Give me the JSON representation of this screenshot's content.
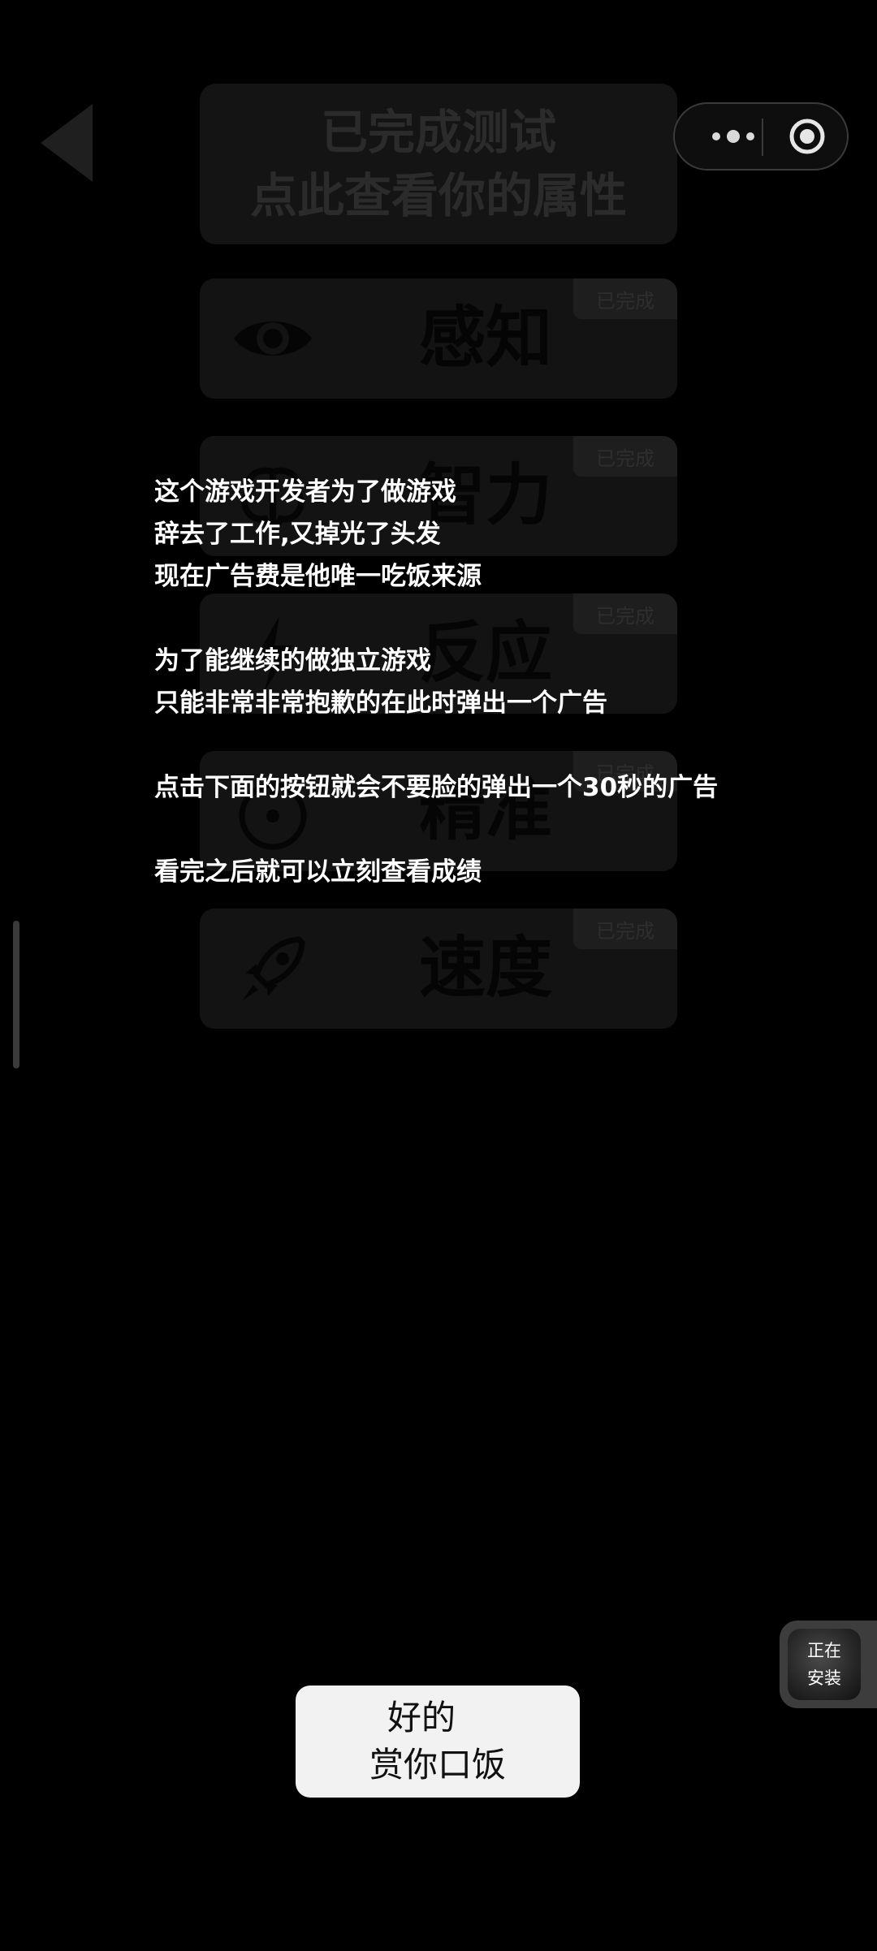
{
  "header": {
    "line1": "已完成测试",
    "line2": "点此查看你的属性"
  },
  "capsule": {
    "menu_icon": "more-dots-icon",
    "close_icon": "target-close-icon"
  },
  "categories": [
    {
      "label": "感知",
      "badge": "已完成",
      "icon": "eye-icon"
    },
    {
      "label": "智力",
      "badge": "已完成",
      "icon": "brain-icon"
    },
    {
      "label": "反应",
      "badge": "已完成",
      "icon": "lightning-icon"
    },
    {
      "label": "精准",
      "badge": "已完成",
      "icon": "crosshair-icon"
    },
    {
      "label": "速度",
      "badge": "已完成",
      "icon": "rocket-icon"
    }
  ],
  "message": {
    "p1_l1": "这个游戏开发者为了做游戏",
    "p1_l2": "辞去了工作,又掉光了头发",
    "p1_l3": "现在广告费是他唯一吃饭来源",
    "p2_l1": "为了能继续的做独立游戏",
    "p2_l2": "只能非常非常抱歉的在此时弹出一个广告",
    "p3_l1": "点击下面的按钮就会不要脸的弹出一个30秒的广告",
    "p4_l1": "看完之后就可以立刻查看成绩"
  },
  "install_badge": {
    "line1": "正在",
    "line2": "安装"
  },
  "ok_button": {
    "line1": "好的",
    "line2": "赏你口饭"
  }
}
